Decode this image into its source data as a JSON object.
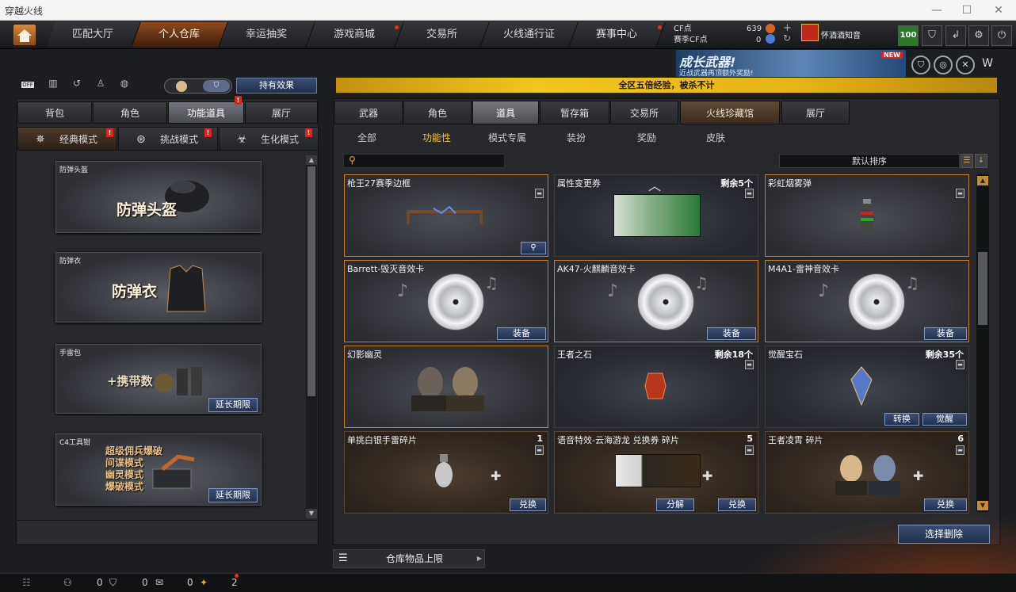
{
  "window": {
    "title": "穿越火线"
  },
  "nav": {
    "tabs": [
      "匹配大厅",
      "个人仓库",
      "幸运抽奖",
      "游戏商城",
      "交易所",
      "火线通行证",
      "赛事中心"
    ],
    "active": "个人仓库"
  },
  "currency": {
    "cf_label": "CF点",
    "cf_value": "639",
    "match_cf_label": "赛季CF点",
    "match_cf_value": "0"
  },
  "user": {
    "name": "怀酒酒知音",
    "level_badge": "100"
  },
  "banner": {
    "title": "成长武器!",
    "subtitle": "近战武器再顶额外奖励!",
    "badge": "NEW"
  },
  "left": {
    "toggle_off": "OFF",
    "effect_button": "持有效果",
    "tabs": [
      "背包",
      "角色",
      "功能道具",
      "展厅"
    ],
    "active_tab": "功能道具",
    "modes": [
      "经典模式",
      "挑战模式",
      "生化模式"
    ],
    "items": [
      {
        "name": "防弹头盔",
        "big": "防弹头盔"
      },
      {
        "name": "防弹衣",
        "big": "防弹衣"
      },
      {
        "name": "手雷包",
        "big": "+携带数",
        "button": "延长期限"
      },
      {
        "name": "C4工具钳",
        "lines": [
          "超级佣兵爆破",
          "间谍模式",
          "幽灵模式",
          "爆破模式"
        ],
        "button": "延长期限"
      }
    ]
  },
  "notice": "全区五倍经验，被杀不计",
  "right": {
    "tabs": [
      "武器",
      "角色",
      "道具",
      "暂存箱",
      "交易所",
      "火线珍藏馆",
      "展厅"
    ],
    "active_tab": "道具",
    "subtabs": [
      "全部",
      "功能性",
      "模式专属",
      "装扮",
      "奖励",
      "皮肤"
    ],
    "active_subtab": "功能性",
    "sort_label": "默认排序",
    "cards": [
      {
        "name": "枪王27赛季边框",
        "count": "",
        "buttons": []
      },
      {
        "name": "属性变更券",
        "count": "剩余5个",
        "buttons": []
      },
      {
        "name": "彩虹烟雾弹",
        "count": "",
        "buttons": []
      },
      {
        "name": "Barrett-毁灭音效卡",
        "count": "",
        "buttons": [
          "装备"
        ]
      },
      {
        "name": "AK47-火麒麟音效卡",
        "count": "",
        "buttons": [
          "装备"
        ]
      },
      {
        "name": "M4A1-雷神音效卡",
        "count": "",
        "buttons": [
          "装备"
        ]
      },
      {
        "name": "幻影幽灵",
        "count": "",
        "buttons": []
      },
      {
        "name": "王者之石",
        "count": "剩余18个",
        "buttons": []
      },
      {
        "name": "觉醒宝石",
        "count": "剩余35个",
        "buttons": [
          "转换",
          "觉醒"
        ]
      },
      {
        "name": "单挑白银手雷碎片",
        "count": "1",
        "buttons": [
          "兑换"
        ]
      },
      {
        "name": "语音特效-云海游龙 兑换券 碎片",
        "count": "5",
        "buttons": [
          "分解",
          "兑换"
        ]
      },
      {
        "name": "王者凌霄 碎片",
        "count": "6",
        "buttons": [
          "兑换"
        ]
      }
    ],
    "delete_button": "选择删除",
    "limit_button": "仓库物品上限"
  },
  "status": {
    "v1": "0",
    "v2": "0",
    "v3": "0",
    "v4": "2"
  }
}
